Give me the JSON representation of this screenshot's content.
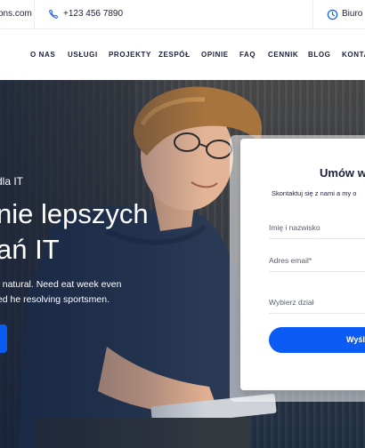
{
  "topbar": {
    "email": "ons.com",
    "phone": "+123 456 7890",
    "hours": "Biuro o"
  },
  "nav": {
    "items": [
      "O NAS",
      "USŁUGI",
      "PROJEKTY",
      "ZESPÓŁ",
      "OPINIE",
      "FAQ",
      "CENNIK",
      "BLOG",
      "KONTA"
    ]
  },
  "hero": {
    "subtitle": "dla IT",
    "title_line1": "nie lepszych",
    "title_line2": "ań IT",
    "text": "n natural. Need eat week even ted he resolving sportsmen."
  },
  "form": {
    "title": "Umów w",
    "subtitle": "Skontaktuj się z nami a my o",
    "fields": {
      "name_placeholder": "Imię i nazwisko",
      "email_placeholder": "Adres email*",
      "department_placeholder": "Wybierz dział"
    },
    "button_label": "Wyśl"
  },
  "colors": {
    "accent": "#0a5cf5",
    "text_dark": "#1b1f3b"
  }
}
